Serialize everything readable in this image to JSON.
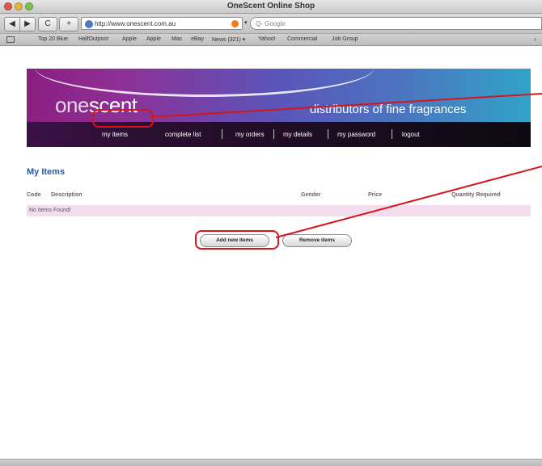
{
  "window": {
    "title": "OneScent Online Shop"
  },
  "toolbar": {
    "back_label": "◀",
    "forward_label": "▶",
    "reload_label": "C",
    "add_label": "+",
    "url": "http://www.onescent.com.au",
    "search_placeholder": "Q- Google"
  },
  "bookmarks": [
    "Top 20 Blue",
    "HalfOutpost",
    "Apple",
    "Apple",
    "Mac",
    "eBay",
    "News (321) ▾",
    "Yahoo!",
    "Commercial",
    "Job Group"
  ],
  "site": {
    "logo_light": "one",
    "logo_bold": "scent",
    "tagline": "distributors of fine fragrances"
  },
  "nav": {
    "items": [
      "my items",
      "complete list",
      "my orders",
      "my details",
      "my password",
      "logout"
    ]
  },
  "page": {
    "title": "My Items",
    "columns": [
      "Code",
      "Description",
      "Gender",
      "Price",
      "Quantity Required"
    ],
    "empty_text": "No Items Found!",
    "add_button": "Add new items",
    "remove_button": "Remove items"
  },
  "colors": {
    "accent_blue": "#2b57a5",
    "callout_red": "#d4161c",
    "row_pink": "#f1dded"
  }
}
